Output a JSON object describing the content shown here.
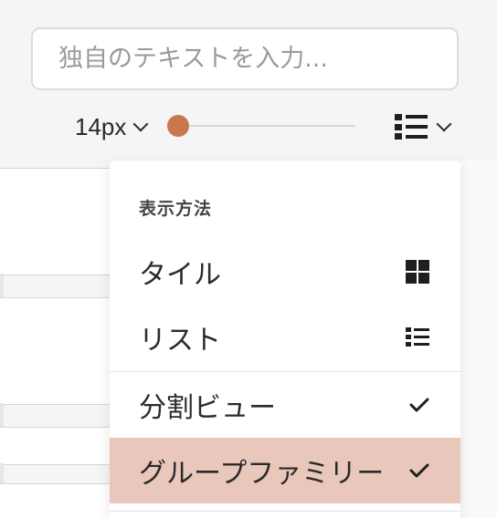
{
  "search": {
    "placeholder": "独自のテキストを入力..."
  },
  "controls": {
    "font_size": {
      "label": "14px",
      "icon": "chevron-down-icon"
    },
    "size_slider": {
      "value_fraction": 0.06
    },
    "view_toggle": {
      "icon": "list-view-icon",
      "chevron": "chevron-down-icon"
    }
  },
  "menu": {
    "header": "表示方法",
    "items": [
      {
        "label": "タイル",
        "icon": "tile-grid-icon"
      },
      {
        "label": "リスト",
        "icon": "list-icon"
      },
      {
        "label": "分割ビュー",
        "icon": "check-icon",
        "checked": true
      },
      {
        "label": "グループファミリー",
        "icon": "check-icon",
        "checked": true,
        "highlighted": true
      }
    ]
  },
  "colors": {
    "accent": "#c8774f",
    "highlight": "#e9c8bb",
    "background": "#f5f5f6",
    "text": "#2a2a2a"
  }
}
